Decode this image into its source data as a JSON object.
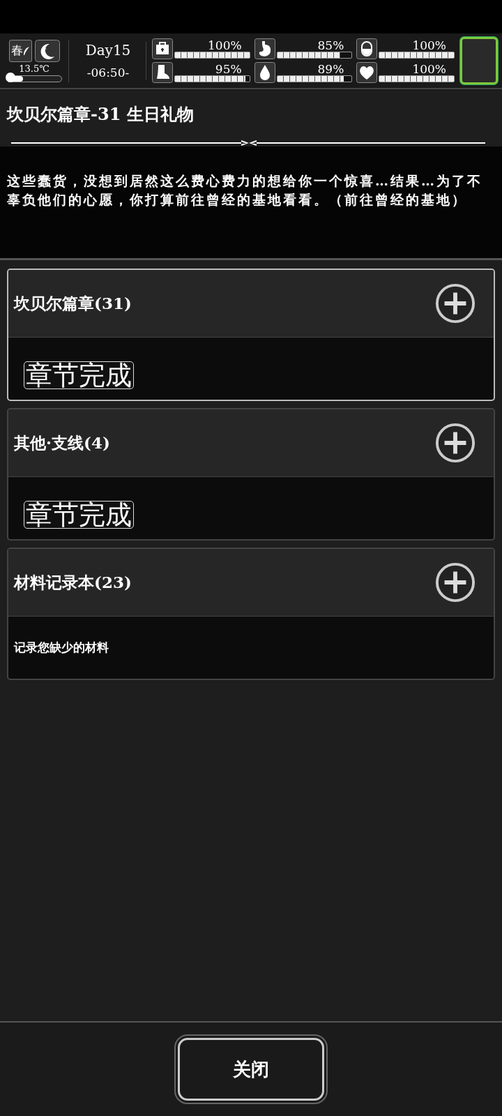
{
  "status_bar": {
    "season": "春",
    "temperature": "13.5℃",
    "temperature_gauge": {
      "level": 0.3
    },
    "day": "Day15",
    "time": "-06:50-",
    "stats": [
      {
        "reading": "100%",
        "level": 1.0
      },
      {
        "reading": "85%",
        "level": 0.85
      },
      {
        "reading": "100%",
        "level": 1.0
      },
      {
        "reading": "95%",
        "level": 0.95
      },
      {
        "reading": "89%",
        "level": 0.89
      },
      {
        "reading": "100%",
        "level": 1.0
      }
    ]
  },
  "quest": {
    "title": "坎贝尔篇章-31 生日礼物",
    "description": "这些蠢货，没想到居然这么费心费力的想给你一个惊喜…结果…为了不辜负他们的心愿，你打算前往曾经的基地看看。（前往曾经的基地）"
  },
  "sections": [
    {
      "title": "坎贝尔篇章(31)",
      "selected": true,
      "kind": "stamp",
      "content": "章节完成"
    },
    {
      "title": "其他·支线(4)",
      "selected": false,
      "kind": "stamp",
      "content": "章节完成"
    },
    {
      "title": "材料记录本(23)",
      "selected": false,
      "kind": "text",
      "content": "记录您缺少的材料"
    }
  ],
  "close_button": "关闭"
}
